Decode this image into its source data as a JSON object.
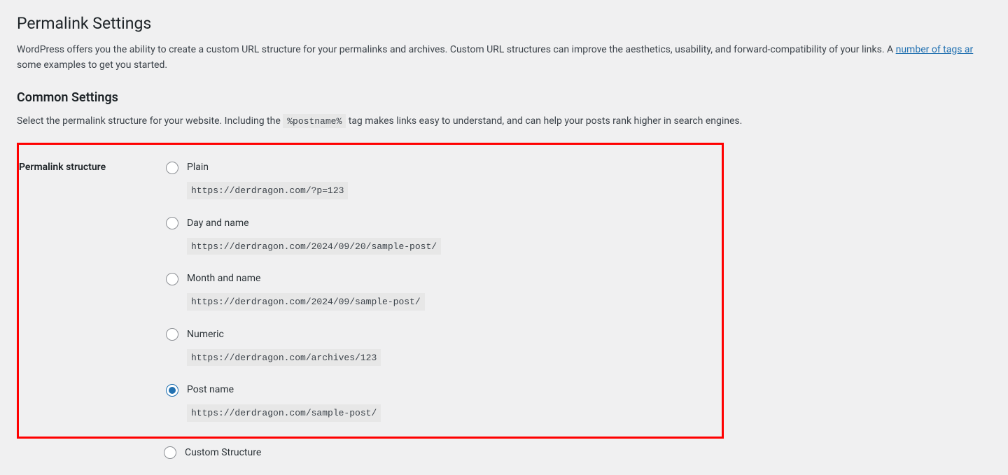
{
  "page": {
    "title": "Permalink Settings",
    "intro_prefix": "WordPress offers you the ability to create a custom URL structure for your permalinks and archives. Custom URL structures can improve the aesthetics, usability, and forward-compatibility of your links. A ",
    "intro_link": "number of tags ar",
    "intro_suffix": " some examples to get you started."
  },
  "common": {
    "heading": "Common Settings",
    "desc_prefix": "Select the permalink structure for your website. Including the ",
    "desc_tag": "%postname%",
    "desc_suffix": " tag makes links easy to understand, and can help your posts rank higher in search engines."
  },
  "structure": {
    "label": "Permalink structure",
    "options": [
      {
        "key": "plain",
        "label": "Plain",
        "url": "https://derdragon.com/?p=123",
        "checked": false
      },
      {
        "key": "day-name",
        "label": "Day and name",
        "url": "https://derdragon.com/2024/09/20/sample-post/",
        "checked": false
      },
      {
        "key": "month-name",
        "label": "Month and name",
        "url": "https://derdragon.com/2024/09/sample-post/",
        "checked": false
      },
      {
        "key": "numeric",
        "label": "Numeric",
        "url": "https://derdragon.com/archives/123",
        "checked": false
      },
      {
        "key": "post-name",
        "label": "Post name",
        "url": "https://derdragon.com/sample-post/",
        "checked": true
      }
    ],
    "custom_label": "Custom Structure"
  }
}
